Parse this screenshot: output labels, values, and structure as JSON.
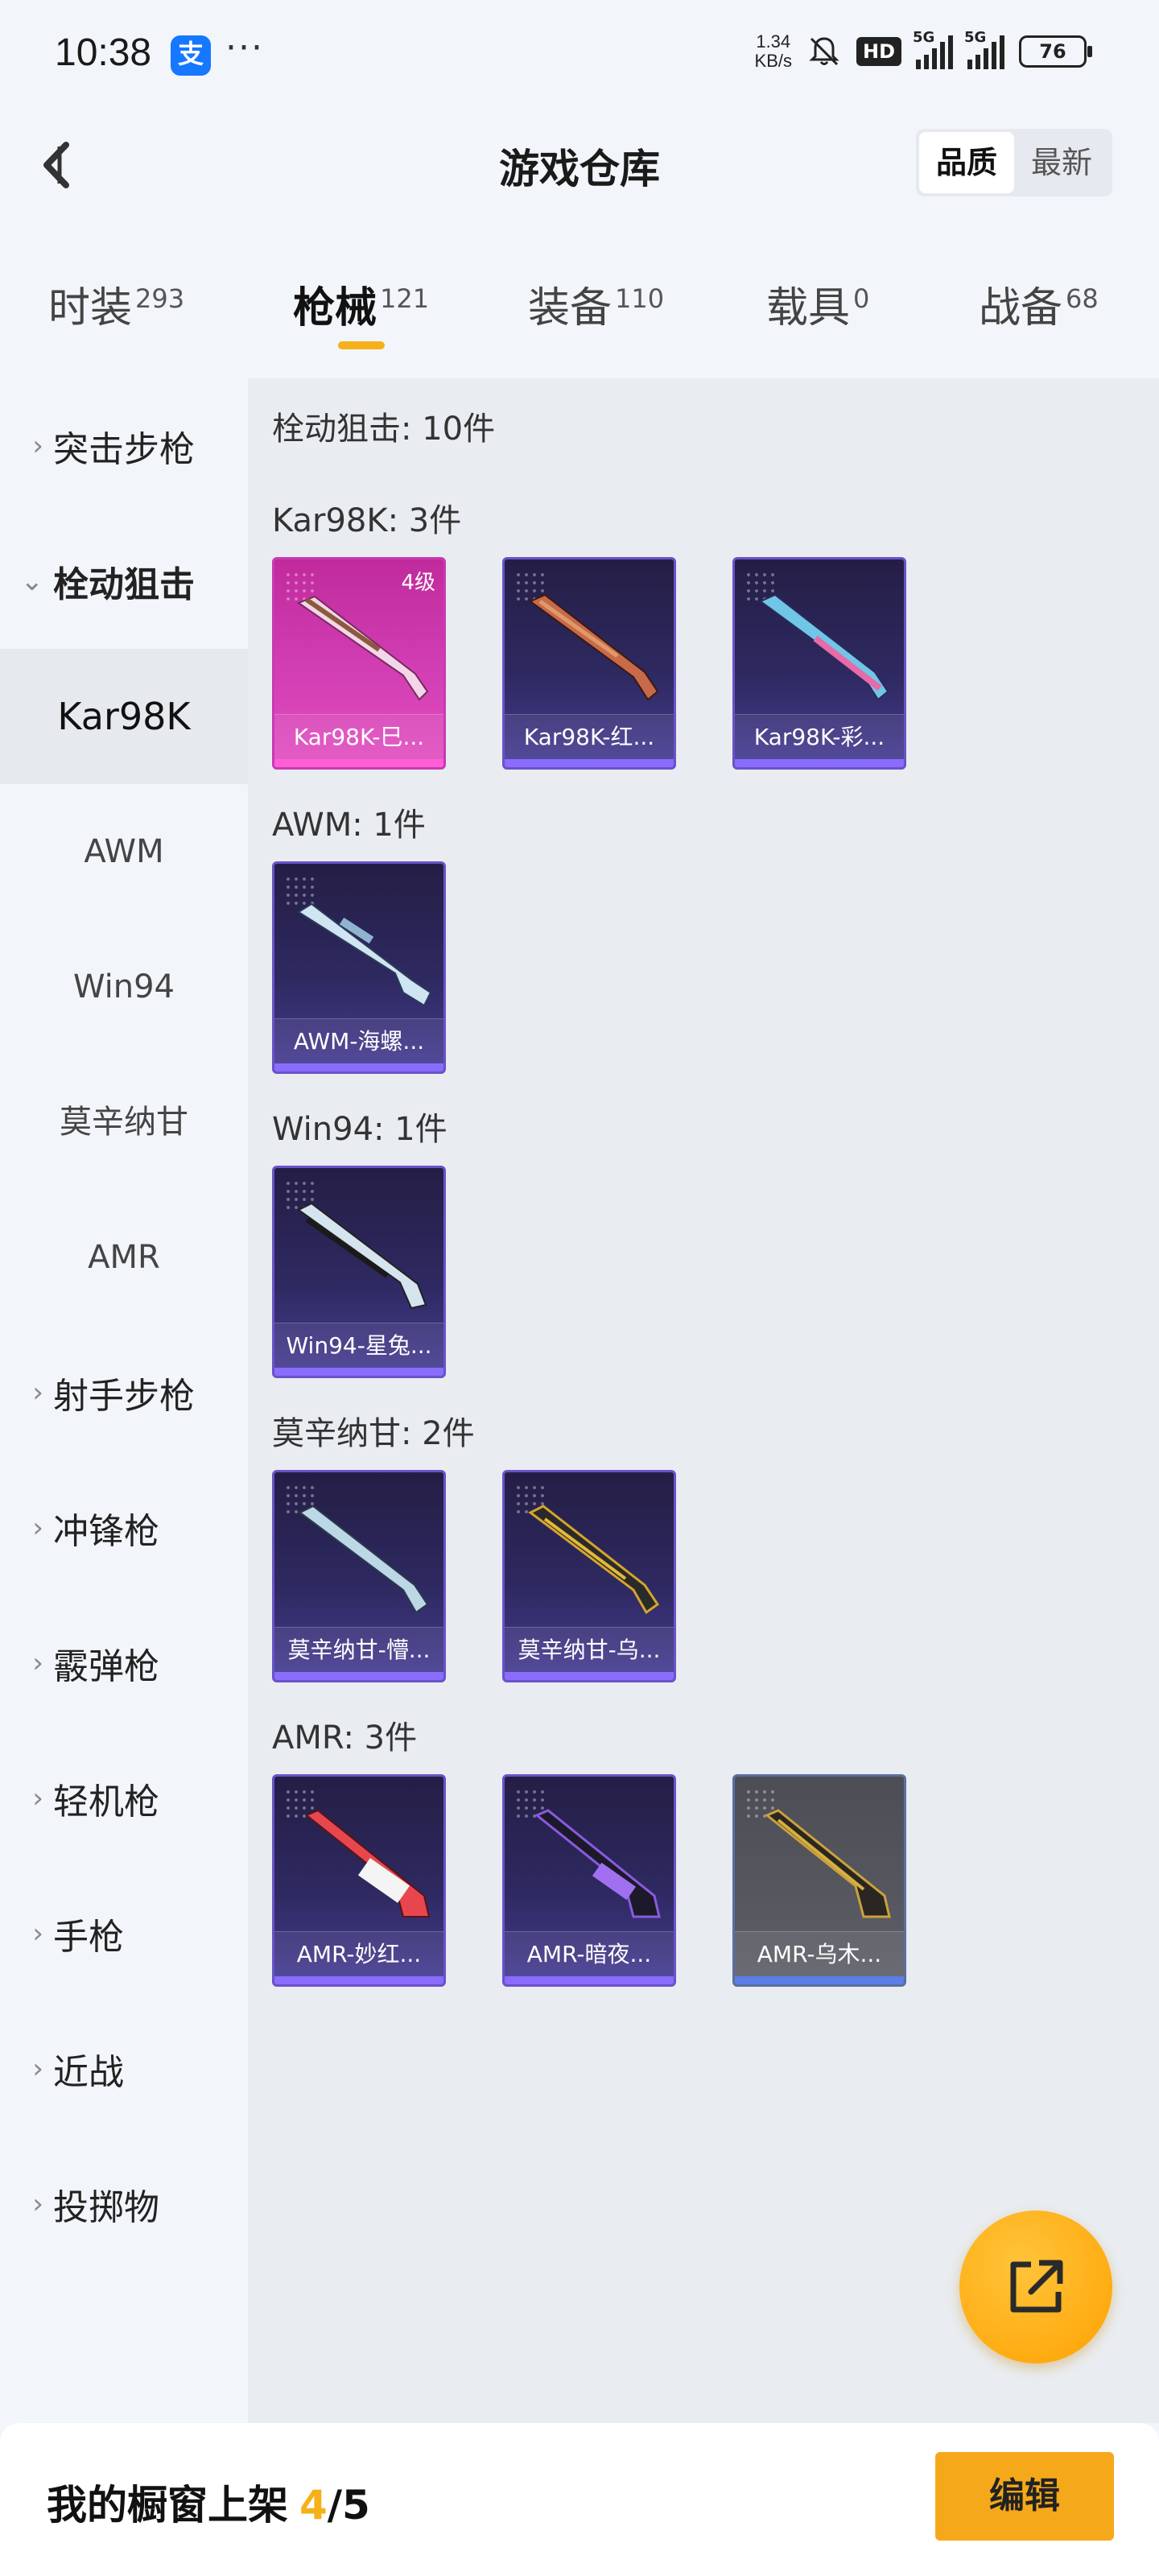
{
  "status": {
    "time": "10:38",
    "app_badge": "支",
    "more": "···",
    "speed_top": "1.34",
    "speed_unit": "KB/s",
    "hd": "HD",
    "net1": "5G",
    "net2": "5G",
    "battery": "76"
  },
  "header": {
    "title": "游戏仓库",
    "sort_quality": "品质",
    "sort_latest": "最新"
  },
  "tabs": [
    {
      "label": "时装",
      "count": "293"
    },
    {
      "label": "枪械",
      "count": "121"
    },
    {
      "label": "装备",
      "count": "110"
    },
    {
      "label": "载具",
      "count": "0"
    },
    {
      "label": "战备",
      "count": "68"
    }
  ],
  "sidebar": {
    "groups": [
      {
        "label": "突击步枪"
      },
      {
        "label": "栓动狙击"
      },
      {
        "label": "射手步枪"
      },
      {
        "label": "冲锋枪"
      },
      {
        "label": "霰弹枪"
      },
      {
        "label": "轻机枪"
      },
      {
        "label": "手枪"
      },
      {
        "label": "近战"
      },
      {
        "label": "投掷物"
      }
    ],
    "subitems": [
      "Kar98K",
      "AWM",
      "Win94",
      "莫辛纳甘",
      "AMR"
    ]
  },
  "content": {
    "summary": "栓动狙击: 10件",
    "sections": [
      {
        "title": "Kar98K: 3件",
        "items": [
          {
            "name": "Kar98K-巳...",
            "level": "4级"
          },
          {
            "name": "Kar98K-红..."
          },
          {
            "name": "Kar98K-彩..."
          }
        ]
      },
      {
        "title": "AWM: 1件",
        "items": [
          {
            "name": "AWM-海螺..."
          }
        ]
      },
      {
        "title": "Win94: 1件",
        "items": [
          {
            "name": "Win94-星兔..."
          }
        ]
      },
      {
        "title": "莫辛纳甘: 2件",
        "items": [
          {
            "name": "莫辛纳甘-懵..."
          },
          {
            "name": "莫辛纳甘-乌..."
          }
        ]
      },
      {
        "title": "AMR: 3件",
        "items": [
          {
            "name": "AMR-妙红..."
          },
          {
            "name": "AMR-暗夜..."
          },
          {
            "name": "AMR-乌木..."
          }
        ]
      }
    ]
  },
  "bottom": {
    "shelf_label": "我的橱窗上架",
    "shelf_count": "4",
    "shelf_total": "/5",
    "edit_label": "编辑"
  },
  "colors": {
    "accent": "#f5b01a",
    "card_purple": "#2e2960",
    "card_pink": "#d13db2",
    "card_gray": "#57575f"
  }
}
